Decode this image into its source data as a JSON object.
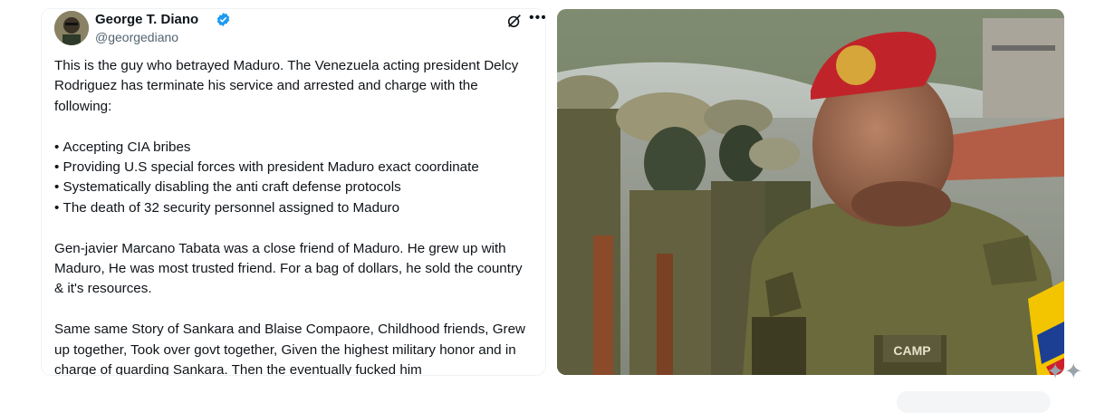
{
  "tweet": {
    "author_name": "George T. Diano",
    "author_handle": "@georgediano",
    "paragraph1": "This is the guy who betrayed Maduro. The Venezuela acting president Delcy Rodriguez has terminate his service and arrested and charge with the following:",
    "bullets": [
      "Accepting CIA bribes",
      "Providing U.S special forces with president Maduro  exact coordinate",
      "Systematically disabling the anti craft defense protocols",
      "The death  of 32 security personnel assigned to Maduro"
    ],
    "paragraph2": "Gen-javier Marcano Tabata was a close friend of Maduro. He grew up with Maduro, He was most trusted friend. For a bag of dollars, he sold the country & it's resources.",
    "paragraph3": "Same same Story of Sankara and Blaise Compaore, Childhood friends, Grew up together, Took over govt together, Given the highest military honor and in charge of guarding Sankara. Then the eventually fucked him"
  },
  "icons": {
    "verified": "verified-badge-icon",
    "grok": "grok-icon",
    "more": "more-icon"
  },
  "photo": {
    "name_tape": "CAMP",
    "colors": {
      "beret": "#c0242a",
      "uniform": "#6b6a3c",
      "flag_yellow": "#f2c500",
      "flag_blue": "#1c3f94",
      "flag_red": "#cf1f2e"
    }
  },
  "colors": {
    "verified": "#1d9bf0",
    "text": "#0f1419",
    "secondary": "#536471"
  }
}
